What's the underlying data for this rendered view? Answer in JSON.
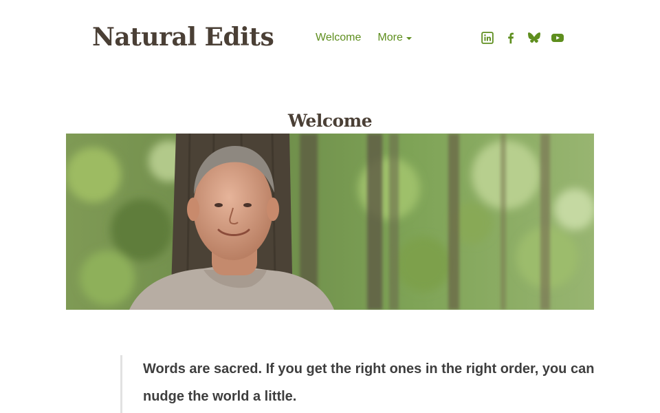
{
  "header": {
    "site_title": "Natural Edits",
    "nav": {
      "welcome_label": "Welcome",
      "more_label": "More"
    },
    "social": [
      {
        "icon": "linkedin-icon"
      },
      {
        "icon": "facebook-icon"
      },
      {
        "icon": "bluesky-icon"
      },
      {
        "icon": "youtube-icon"
      }
    ]
  },
  "main": {
    "page_title": "Welcome",
    "hero_image": {
      "subject": "portrait-photo"
    },
    "quote": "Words are sacred. If you get the right ones in the right order, you can nudge the world a little."
  },
  "colors": {
    "accent": "#5e8e1e",
    "title": "#4a3f35",
    "body_text": "#3e3e3e",
    "quote_border": "#e2e2e2"
  }
}
